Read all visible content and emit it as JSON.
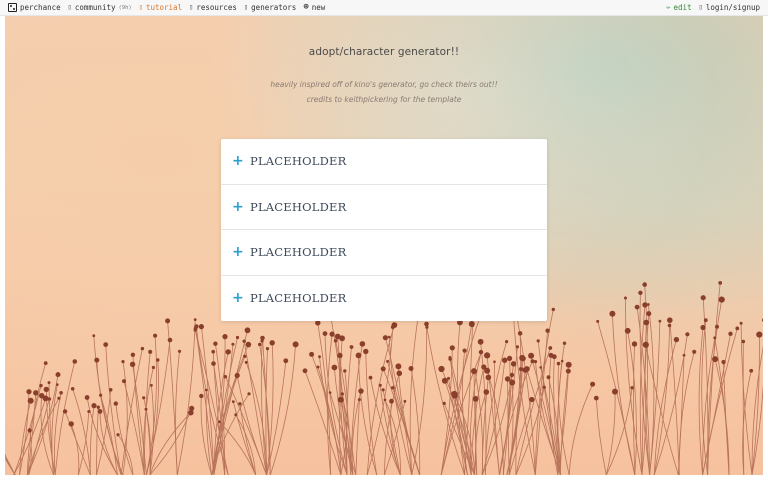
{
  "nav": {
    "left": [
      {
        "name": "perchance",
        "label": "perchance",
        "icon": "dice-icon"
      },
      {
        "name": "community",
        "label": "community",
        "count": "(9h)",
        "icon": "people-icon"
      },
      {
        "name": "tutorial",
        "label": "tutorial",
        "icon": "book-icon"
      },
      {
        "name": "resources",
        "label": "resources",
        "icon": "folder-icon"
      },
      {
        "name": "generators",
        "label": "generators",
        "icon": "grid-icon"
      },
      {
        "name": "new",
        "label": "new",
        "icon": "plus-circle-icon"
      }
    ],
    "right": [
      {
        "name": "edit",
        "label": "edit",
        "icon": "pencil-icon"
      },
      {
        "name": "login",
        "label": "login/signup",
        "icon": "user-icon"
      }
    ]
  },
  "page": {
    "title": "adopt/character generator!!",
    "subtitle_1": "heavily inspired off of kino's generator, go check theirs out!!",
    "subtitle_2": "credits to keithpickering for the template"
  },
  "accordion": {
    "items": [
      {
        "label": "PLACEHOLDER",
        "icon": "plus-icon"
      },
      {
        "label": "PLACEHOLDER",
        "icon": "plus-icon"
      },
      {
        "label": "PLACEHOLDER",
        "icon": "plus-icon"
      },
      {
        "label": "PLACEHOLDER",
        "icon": "plus-icon"
      }
    ]
  },
  "colors": {
    "accent": "#2a9fd0",
    "tutorial": "#d9772b",
    "edit": "#2f8a35"
  }
}
